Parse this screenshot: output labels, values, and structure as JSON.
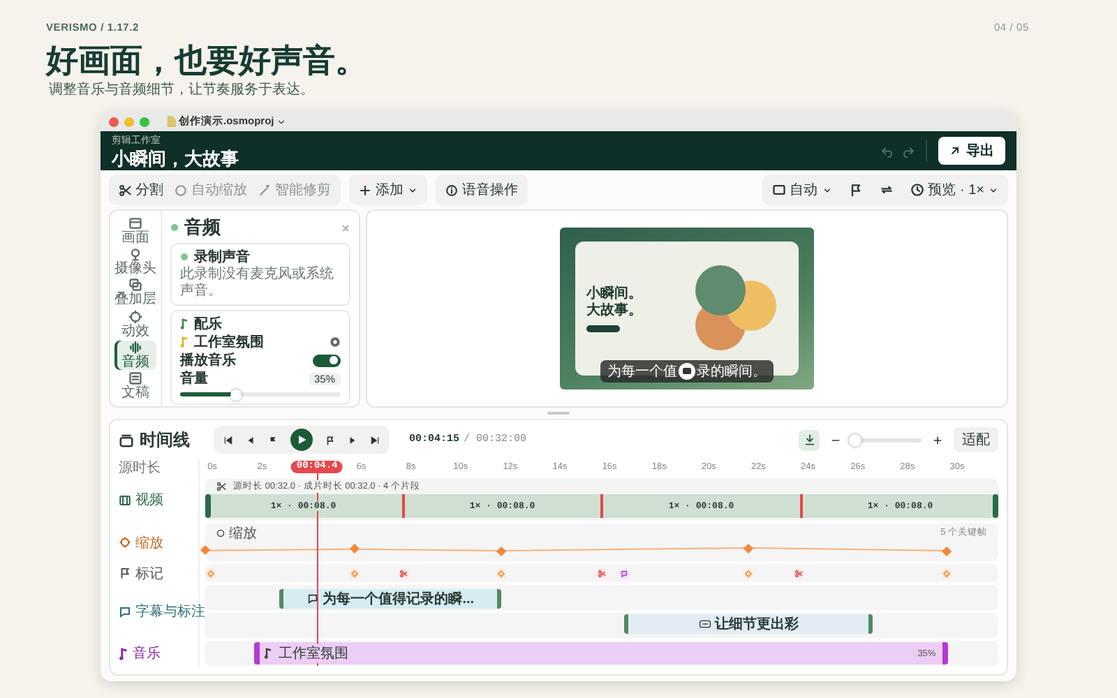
{
  "header": {
    "brand": "VERISMO / 1.17.2",
    "page": "04 / 05",
    "title": "好画面，也要好声音。",
    "subtitle": "调整音乐与音频细节，让节奏服务于表达。"
  },
  "window": {
    "file": "创作演示.osmoproj",
    "studio": "剪辑工作室",
    "project": "小瞬间，大故事",
    "export": "导出"
  },
  "toolbar": {
    "tools": [
      {
        "kind": "split",
        "label": "分割",
        "disabled": false
      },
      {
        "kind": "auto",
        "label": "自动缩放",
        "disabled": true
      },
      {
        "kind": "trim",
        "label": "智能修剪",
        "disabled": true
      }
    ],
    "add": "添加",
    "voice": "语音操作",
    "layout": "自动",
    "preview": "预览 · 1×"
  },
  "sidebar": {
    "items": [
      {
        "kind": "canvas",
        "label": "画面",
        "selected": false
      },
      {
        "kind": "camera",
        "label": "摄像头",
        "selected": false
      },
      {
        "kind": "overlay",
        "label": "叠加层",
        "selected": false
      },
      {
        "kind": "motion",
        "label": "动效",
        "selected": false
      },
      {
        "kind": "audio",
        "label": "音频",
        "selected": true
      },
      {
        "kind": "script",
        "label": "文稿",
        "selected": false
      }
    ]
  },
  "audio": {
    "title": "音频",
    "record": {
      "title": "录制声音",
      "note": "此录制没有麦克风或系统声音。"
    },
    "music": {
      "heading": "配乐",
      "track": "工作室氛围",
      "play_label": "播放音乐",
      "playing": true,
      "volume_label": "音量",
      "volume": "35%",
      "level": 0.35
    }
  },
  "preview": {
    "slide_title": [
      "小瞬间。",
      "大故事。"
    ],
    "caption_start": "为每一个值",
    "caption_end": "录的瞬间。"
  },
  "timeline": {
    "title": "时间线",
    "time": "00:04:15",
    "total": "/ 00:32:00",
    "playhead": "00:04.4",
    "zoom": {
      "level": 0.05
    },
    "fit": "适配",
    "ticks": [
      "0s",
      "2s",
      "6s",
      "8s",
      "10s",
      "12s",
      "14s",
      "16s",
      "18s",
      "20s",
      "22s",
      "24s",
      "26s",
      "28s",
      "30s"
    ],
    "labels": {
      "source": "源时长",
      "video": "视频",
      "zoom": "缩放",
      "markers": "标记",
      "captions": "字幕与标注",
      "music": "音乐"
    },
    "video": {
      "info": "源时长 00:32.0 · 成片时长 00:32.0 · 4 个片段",
      "clips": [
        "1× · 00:08.0",
        "1× · 00:08.0",
        "1× · 00:08.0",
        "1× · 00:08.0"
      ]
    },
    "zoom_track": {
      "label": "缩放",
      "count": "5 个关键帧"
    },
    "markers": [
      {
        "kind": "keyframe"
      },
      {
        "kind": "keyframe"
      },
      {
        "kind": "cut"
      },
      {
        "kind": "keyframe"
      },
      {
        "kind": "cut"
      },
      {
        "kind": "comment"
      },
      {
        "kind": "keyframe"
      },
      {
        "kind": "cut"
      },
      {
        "kind": "keyframe"
      }
    ],
    "captions": [
      {
        "kind": "subtitle",
        "text": "为每一个值得记录的瞬..."
      },
      {
        "kind": "annotation",
        "text": "让细节更出彩"
      }
    ],
    "music": {
      "track": "工作室氛围",
      "volume": "35%"
    }
  }
}
